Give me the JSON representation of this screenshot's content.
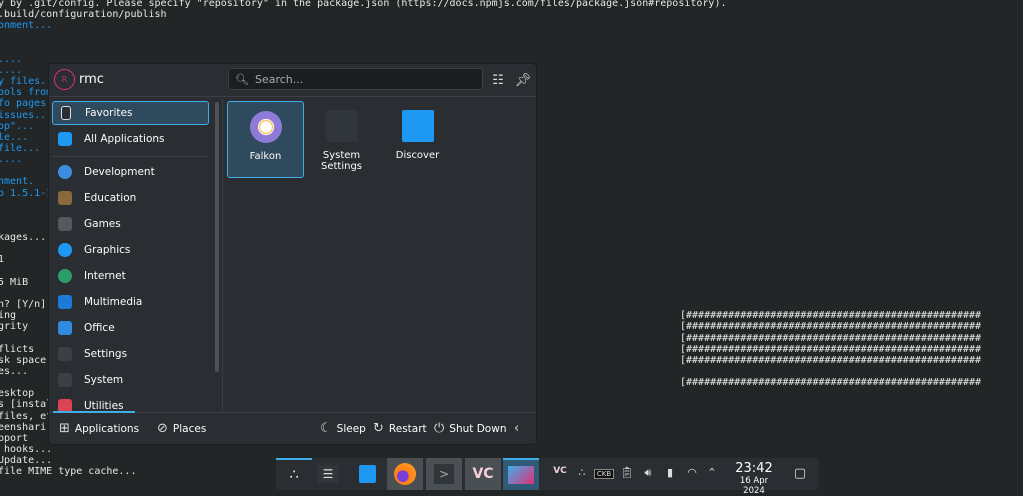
{
  "terminal_left": [
    {
      "line": 0,
      "text": "y by .git/config. Please specify \"repository\" in the package.json (https://docs.npmjs.com/files/package.json#repository).",
      "color": "white"
    },
    {
      "line": 1,
      "text": ".build/configuration/publish",
      "color": "white"
    },
    {
      "line": 2,
      "text": "onment...",
      "color": "blue"
    },
    {
      "line": 5,
      "text": "....",
      "color": "blue"
    },
    {
      "line": 6,
      "text": "....",
      "color": "blue"
    },
    {
      "line": 7,
      "text": "y files...",
      "color": "blue"
    },
    {
      "line": 8,
      "text": "bols from",
      "color": "blue"
    },
    {
      "line": 9,
      "text": "fo pages.",
      "color": "blue"
    },
    {
      "line": 10,
      "text": "issues...",
      "color": "blue"
    },
    {
      "line": 11,
      "text": "op\"...",
      "color": "blue"
    },
    {
      "line": 12,
      "text": "le...",
      "color": "blue"
    },
    {
      "line": 13,
      "text": "file...",
      "color": "blue"
    },
    {
      "line": 14,
      "text": "....",
      "color": "blue"
    },
    {
      "line": 16,
      "text": "nment.",
      "color": "blue"
    },
    {
      "line": 17,
      "text": "p 1.5.1-1",
      "color": "blue"
    },
    {
      "line": 21,
      "text": "kages...",
      "color": "white"
    },
    {
      "line": 23,
      "text": "1",
      "color": "white"
    },
    {
      "line": 25,
      "text": "5 MiB",
      "color": "white"
    },
    {
      "line": 27,
      "text": "n? [Y/n]",
      "color": "white"
    },
    {
      "line": 28,
      "text": "ing",
      "color": "white"
    },
    {
      "line": 29,
      "text": "grity",
      "color": "white"
    },
    {
      "line": 31,
      "text": "flicts",
      "color": "white"
    },
    {
      "line": 32,
      "text": "sk space",
      "color": "white"
    },
    {
      "line": 33,
      "text": "es...",
      "color": "white"
    },
    {
      "line": 35,
      "text": "esktop",
      "color": "white"
    },
    {
      "line": 36,
      "text": "s [instal",
      "color": "white"
    },
    {
      "line": 37,
      "text": "files, et",
      "color": "white"
    },
    {
      "line": 38,
      "text": "eenshari",
      "color": "white"
    },
    {
      "line": 39,
      "text": "pport",
      "color": "white"
    },
    {
      "line": 40,
      "text": " hooks...",
      "color": "white"
    },
    {
      "line": 41,
      "text": "Update...",
      "color": "white"
    },
    {
      "line": 42,
      "text": "file MIME type cache...",
      "color": "white"
    }
  ],
  "terminal_right": [
    {
      "line": 28,
      "text": "[#################################################"
    },
    {
      "line": 29,
      "text": "[#################################################"
    },
    {
      "line": 30,
      "text": "[#################################################"
    },
    {
      "line": 31,
      "text": "[#################################################"
    },
    {
      "line": 32,
      "text": "[#################################################"
    },
    {
      "line": 34,
      "text": "[#################################################"
    }
  ],
  "menu": {
    "user": {
      "initial": "R",
      "name": "rmc"
    },
    "search": {
      "placeholder": "Search..."
    },
    "categories": [
      {
        "label": "Favorites",
        "icon": "bookmark-icon",
        "color": "#2a2e32"
      },
      {
        "label": "All Applications",
        "icon": "grid-icon",
        "color": "#1d99f3"
      },
      {
        "label": "Development",
        "icon": "hammer-icon",
        "color": "#3d8ee0"
      },
      {
        "label": "Education",
        "icon": "chalkboard-icon",
        "color": "#8a6a3a"
      },
      {
        "label": "Games",
        "icon": "gamepad-icon",
        "color": "#555a5f"
      },
      {
        "label": "Graphics",
        "icon": "graphics-icon",
        "color": "#1d99f3"
      },
      {
        "label": "Internet",
        "icon": "globe-icon",
        "color": "#2a9d6a"
      },
      {
        "label": "Multimedia",
        "icon": "multimedia-icon",
        "color": "#1d7ad8"
      },
      {
        "label": "Office",
        "icon": "office-icon",
        "color": "#2f8ae0"
      },
      {
        "label": "Settings",
        "icon": "settings-icon",
        "color": "#3b4045"
      },
      {
        "label": "System",
        "icon": "system-icon",
        "color": "#3b4045"
      },
      {
        "label": "Utilities",
        "icon": "toolbox-icon",
        "color": "#da4453"
      }
    ],
    "apps": [
      {
        "label": "Falkon",
        "icon": "falkon-icon"
      },
      {
        "label": "System Settings",
        "icon": "system-settings-icon"
      },
      {
        "label": "Discover",
        "icon": "discover-icon"
      }
    ],
    "footer": {
      "applications": "Applications",
      "places": "Places",
      "sleep": "Sleep",
      "restart": "Restart",
      "shutdown": "Shut Down"
    }
  },
  "taskbar": {
    "time": "23:42",
    "date": "16 Apr 2024",
    "tray_keyboard": "CKB"
  }
}
